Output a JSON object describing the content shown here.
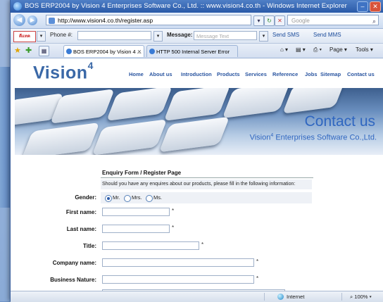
{
  "window": {
    "title": "BOS ERP2004 by Vision 4 Enterprises Software Co., Ltd. :: www.vision4.co.th - Windows Internet Explorer",
    "min_glyph": "–",
    "close_glyph": "✕"
  },
  "address_bar": {
    "back_glyph": "◀",
    "forward_glyph": "▶",
    "url": "http://www.vision4.co.th/register.asp",
    "dropdown_glyph": "▾",
    "refresh_glyph": "↻",
    "stop_glyph": "✕",
    "search_placeholder": "Google",
    "search_glyph": "⌕"
  },
  "messenger_bar": {
    "logo_text": "ดีแทค",
    "phone_label": "Phone #:",
    "phone_value": "",
    "message_label": "Message:",
    "message_placeholder": "Message Text",
    "send_sms_label": "Send SMS",
    "send_mms_label": "Send MMS"
  },
  "tab_bar": {
    "tabs": [
      {
        "label": "BOS ERP2004 by Vision 4 ...",
        "active": true,
        "close": "✕"
      },
      {
        "label": "HTTP 500 Internal Server Error",
        "active": false
      }
    ],
    "commands": {
      "page": "Page ▾",
      "tools": "Tools ▾"
    }
  },
  "site": {
    "logo_text": "Vision",
    "logo_sup": "4",
    "nav": [
      "Home",
      "About us",
      "Introduction",
      "Products",
      "Services",
      "Reference",
      "Jobs",
      "Sitemap",
      "Contact us"
    ],
    "banner_title": "Contact us",
    "banner_subtitle_pre": "Vision",
    "banner_subtitle_sup": "4",
    "banner_subtitle_post": " Enterprises Software Co.,Ltd."
  },
  "form": {
    "title": "Enquiry Form / Register Page",
    "intro": "Should you have any enquires about our products, please fill in the following information:",
    "gender_label": "Gender:",
    "gender_options": [
      "Mr.",
      "Mrs.",
      "Ms."
    ],
    "gender_selected": "Mr.",
    "required_mark": "*",
    "fields": [
      {
        "label": "First name:",
        "value": ""
      },
      {
        "label": "Last name:",
        "value": ""
      },
      {
        "label": "Title:",
        "value": ""
      },
      {
        "label": "Company name:",
        "value": ""
      },
      {
        "label": "Business Nature:",
        "value": ""
      }
    ]
  },
  "status_bar": {
    "zone": "Internet",
    "zoom": "100%"
  },
  "colors": {
    "accent": "#3a68a7",
    "titlebar": "#2a5aa8",
    "link": "#2a55a0"
  }
}
